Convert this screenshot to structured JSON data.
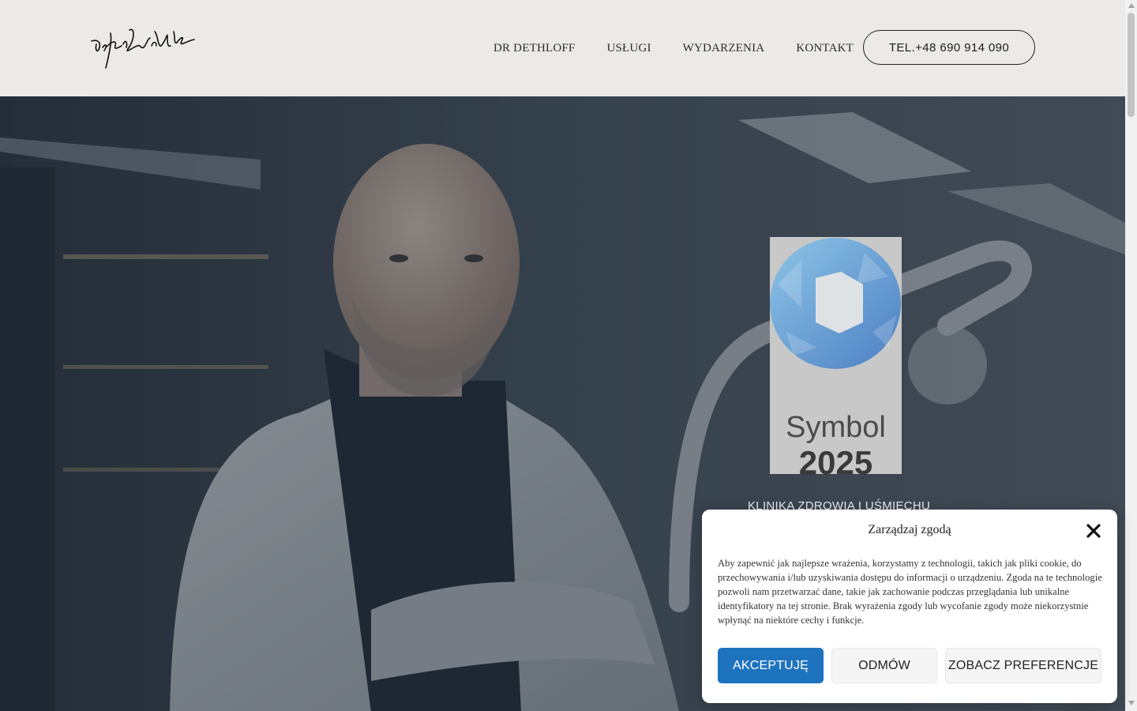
{
  "header": {
    "logo_text": "Dr Jan Dethloff",
    "nav": [
      "DR DETHLOFF",
      "USŁUGI",
      "WYDARZENIA",
      "KONTAKT"
    ],
    "phone_button": "TEL.+48 690 914 090"
  },
  "hero": {
    "award_word": "Symbol",
    "award_year": "2025",
    "clinic_line": "KLINIKA ZDROWIA I UŚMIECHU"
  },
  "cookie": {
    "title": "Zarządzaj zgodą",
    "text": "Aby zapewnić jak najlepsze wrażenia, korzystamy z technologii, takich jak pliki cookie, do przechowywania i/lub uzyskiwania dostępu do informacji o urządzeniu. Zgoda na te technologie pozwoli nam przetwarzać dane, takie jak zachowanie podczas przeglądania lub unikalne identyfikatory na tej stronie. Brak wyrażenia zgody lub wycofanie zgody może niekorzystnie wpłynąć na niektóre cechy i funkcje.",
    "accept": "AKCEPTUJĘ",
    "deny": "ODMÓW",
    "preferences": "ZOBACZ PREFERENCJE"
  },
  "colors": {
    "header_bg": "#ebeae8",
    "accent": "#1e73be"
  }
}
